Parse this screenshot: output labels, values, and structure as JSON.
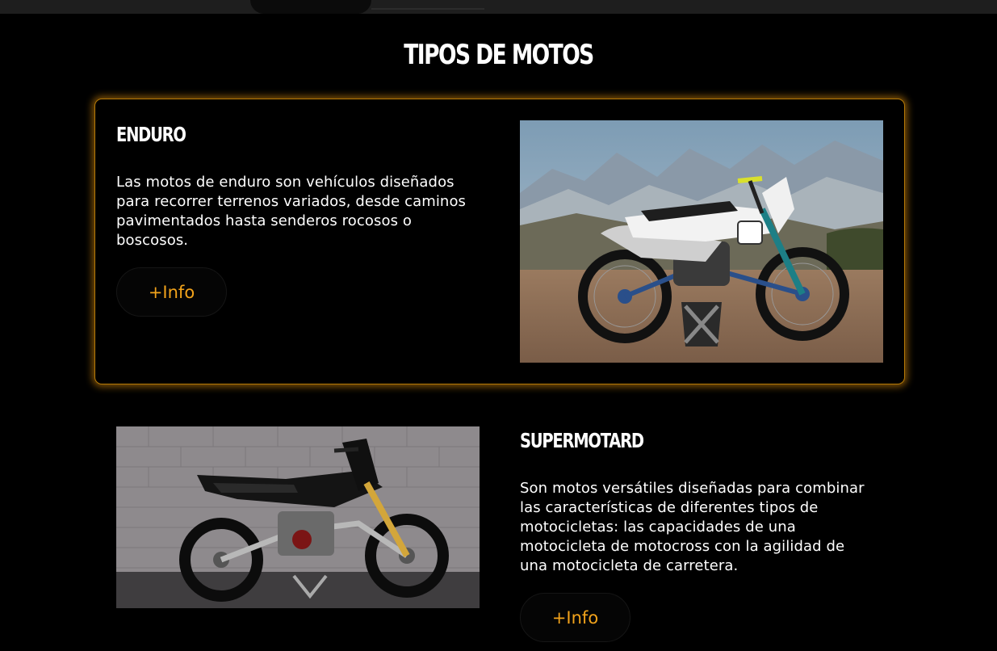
{
  "section": {
    "title": "TIPOS DE MOTOS"
  },
  "cards": [
    {
      "title": "ENDURO",
      "text": "Las motos de enduro son vehículos diseñados para recorrer terrenos variados, desde caminos pavimentados hasta senderos rocosos o boscosos.",
      "button_label": "+Info"
    },
    {
      "title": "SUPERMOTARD",
      "text": "Son motos versátiles diseñadas para combinar las características de diferentes tipos de motocicletas: las capacidades de una motocicleta de motocross con la agilidad de una motocicleta de carretera.",
      "button_label": "+Info"
    }
  ],
  "colors": {
    "background": "#000000",
    "accent": "#f2a31b",
    "card_glow": "#e2910e"
  }
}
